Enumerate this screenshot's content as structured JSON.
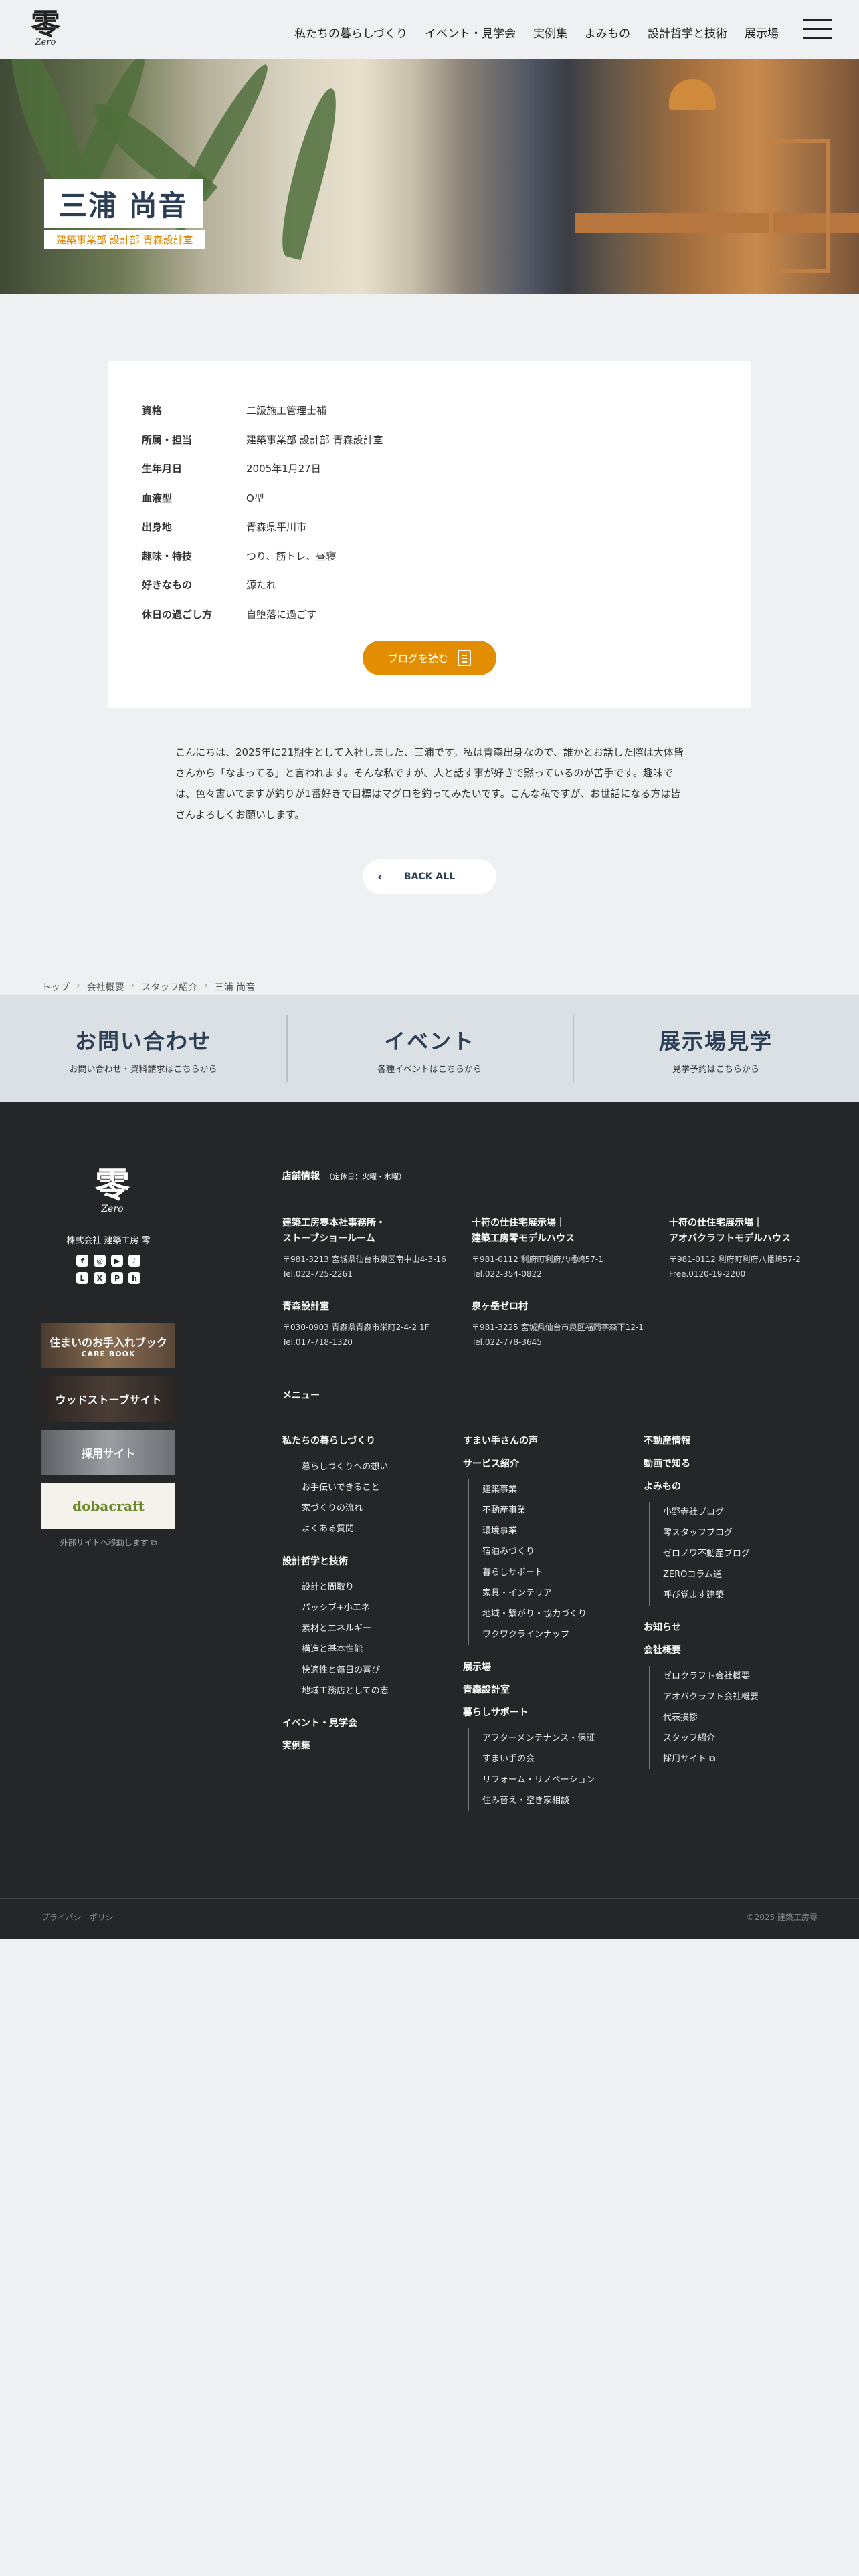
{
  "header": {
    "logo_kanji": "零",
    "logo_roman": "Zero",
    "nav": [
      "私たちの暮らしづくり",
      "イベント・見学会",
      "実例集",
      "よみもの",
      "設計哲学と技術",
      "展示場"
    ]
  },
  "hero": {
    "name": "三浦 尚音",
    "dept": "建築事業部 設計部 青森設計室"
  },
  "profile": {
    "rows": [
      {
        "k": "資格",
        "v": "二級施工管理士補"
      },
      {
        "k": "所属・担当",
        "v": "建築事業部 設計部 青森設計室"
      },
      {
        "k": "生年月日",
        "v": "2005年1月27日"
      },
      {
        "k": "血液型",
        "v": "O型"
      },
      {
        "k": "出身地",
        "v": "青森県平川市"
      },
      {
        "k": "趣味・特技",
        "v": "つり、筋トレ、昼寝"
      },
      {
        "k": "好きなもの",
        "v": "源たれ"
      },
      {
        "k": "休日の過ごし方",
        "v": "自堕落に過ごす"
      }
    ],
    "blog_label": "ブログを読む"
  },
  "intro": "こんにちは、2025年に21期生として入社しました、三浦です。私は青森出身なので、誰かとお話した際は大体皆さんから「なまってる」と言われます。そんな私ですが、人と話す事が好きで黙っているのが苦手です。趣味では、色々書いてますが釣りが1番好きで目標はマグロを釣ってみたいです。こんな私ですが、お世話になる方は皆さんよろしくお願いします。",
  "back_label": "BACK ALL",
  "breadcrumbs": [
    "トップ",
    "会社概要",
    "スタッフ紹介",
    "三浦 尚音"
  ],
  "cta": [
    {
      "title": "お問い合わせ",
      "pre": "お問い合わせ・資料請求は",
      "link": "こちら",
      "post": "から"
    },
    {
      "title": "イベント",
      "pre": "各種イベントは",
      "link": "こちら",
      "post": "から"
    },
    {
      "title": "展示場見学",
      "pre": "見学予約は",
      "link": "こちら",
      "post": "から"
    }
  ],
  "footer": {
    "logo_kanji": "零",
    "logo_roman": "Zero",
    "company": "株式会社 建築工房 零",
    "social": [
      "f",
      "◎",
      "▶",
      "♪",
      "L",
      "X",
      "P",
      "h"
    ],
    "banners": [
      {
        "t": "住まいのお手入れブック",
        "s": "CARE BOOK",
        "color": "#6b5a48"
      },
      {
        "t": "ウッドストーブサイト",
        "s": "",
        "color": "#3b3330"
      },
      {
        "t": "採用サイト",
        "s": "",
        "color": "#7d8186"
      },
      {
        "t": "dobacraft",
        "s": "",
        "color": "#f2f0e6"
      }
    ],
    "ext_note": "外部サイトへ移動します ⧉",
    "shop_heading": "店舗情報",
    "shop_note": "（定休日：火曜・水曜）",
    "shops": [
      {
        "n1": "建築工房零本社事務所・",
        "n2": "ストーブショールーム",
        "addr": "〒981-3213 宮城県仙台市泉区南中山4-3-16",
        "tel": "Tel.022-725-2261"
      },
      {
        "n1": "十符の仕住宅展示場｜",
        "n2": "建築工房零モデルハウス",
        "addr": "〒981-0112 利府町利府八幡崎57-1",
        "tel": "Tel.022-354-0822"
      },
      {
        "n1": "十符の仕住宅展示場｜",
        "n2": "アオバクラフトモデルハウス",
        "addr": "〒981-0112 利府町利府八幡崎57-2",
        "tel": "Free.0120-19-2200"
      },
      {
        "n1": "青森設計室",
        "n2": "",
        "addr": "〒030-0903 青森県青森市栄町2-4-2 1F",
        "tel": "Tel.017-718-1320"
      },
      {
        "n1": "泉ヶ岳ゼロ村",
        "n2": "",
        "addr": "〒981-3225 宮城県仙台市泉区福岡字森下12-1",
        "tel": "Tel.022-778-3645"
      }
    ],
    "menu_heading": "メニュー",
    "menu": {
      "col1": [
        {
          "main": "私たちの暮らしづくり",
          "subs": [
            "暮らしづくりへの想い",
            "お手伝いできること",
            "家づくりの流れ",
            "よくある質問"
          ]
        },
        {
          "main": "設計哲学と技術",
          "subs": [
            "設計と間取り",
            "パッシブ+小エネ",
            "素材とエネルギー",
            "構造と基本性能",
            "快適性と毎日の喜び",
            "地域工務店としての志"
          ]
        },
        {
          "main": "イベント・見学会",
          "subs": []
        },
        {
          "main": "実例集",
          "subs": []
        }
      ],
      "col2": [
        {
          "main": "すまい手さんの声",
          "subs": []
        },
        {
          "main": "サービス紹介",
          "subs": [
            "建築事業",
            "不動産事業",
            "環境事業",
            "宿泊みづくり",
            "暮らしサポート",
            "家具・インテリア",
            "地域・繋がり・協力づくり",
            "ワクワクラインナップ"
          ]
        },
        {
          "main": "展示場",
          "subs": []
        },
        {
          "main": "青森設計室",
          "subs": []
        },
        {
          "main": "暮らしサポート",
          "subs": [
            "アフターメンテナンス・保証",
            "すまい手の会",
            "リフォーム・リノベーション",
            "住み替え・空き家相談"
          ]
        }
      ],
      "col3": [
        {
          "main": "不動産情報",
          "subs": []
        },
        {
          "main": "動画で知る",
          "subs": []
        },
        {
          "main": "よみもの",
          "subs": [
            "小野寺社ブログ",
            "零スタッフブログ",
            "ゼロノワ不動産ブログ",
            "ZEROコラム通",
            "呼び覚ます建築"
          ]
        },
        {
          "main": "お知らせ",
          "subs": []
        },
        {
          "main": "会社概要",
          "subs": [
            "ゼロクラフト会社概要",
            "アオバクラフト会社概要",
            "代表挨拶",
            "スタッフ紹介",
            "採用サイト ⧉"
          ]
        }
      ]
    },
    "policy": "プライバシーポリシー",
    "copyright": "©2025 建築工房零"
  }
}
